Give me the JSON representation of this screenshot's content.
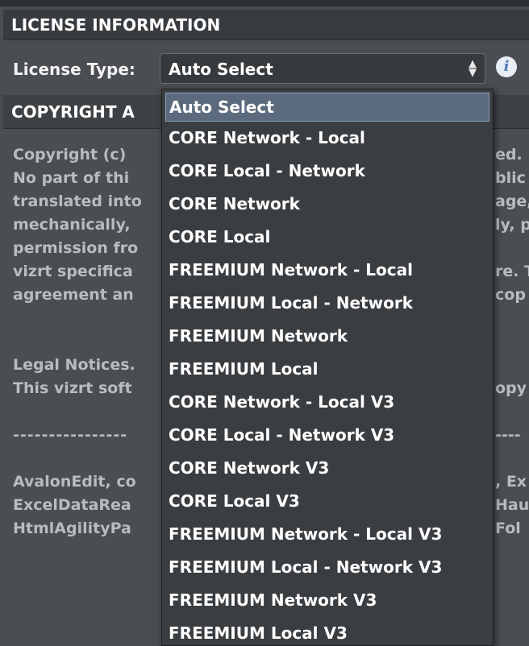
{
  "license_section": {
    "title": "LICENSE INFORMATION",
    "license_type_label": "License Type:",
    "selected_value": "Auto Select",
    "select_arrows": "▲▼",
    "info_glyph": "i"
  },
  "copyright_section": {
    "title_visible": "COPYRIGHT A",
    "lines_left": [
      "Copyright (c)",
      "No part of thi",
      "translated into",
      "mechanically,",
      "permission fro",
      "vizrt specifica",
      "agreement an",
      "",
      "",
      "Legal Notices.",
      "This vizrt soft",
      "",
      "----------------",
      "",
      "AvalonEdit, co",
      "ExcelDataRea",
      "HtmlAgilityPa"
    ],
    "lines_right": [
      "ed.",
      "blic",
      "age,",
      "ly, p",
      "",
      "re. T",
      "cop",
      "",
      "",
      "",
      "opy",
      "",
      "----",
      "",
      ", Ex",
      "Hau",
      "Fol"
    ]
  },
  "dropdown": {
    "options": [
      "Auto Select",
      "CORE Network - Local",
      "CORE Local - Network",
      "CORE Network",
      "CORE Local",
      "FREEMIUM Network - Local",
      "FREEMIUM Local - Network",
      "FREEMIUM Network",
      "FREEMIUM Local",
      "CORE Network - Local V3",
      "CORE Local - Network V3",
      "CORE Network V3",
      "CORE Local V3",
      "FREEMIUM Network - Local V3",
      "FREEMIUM Local - Network V3",
      "FREEMIUM Network V3",
      "FREEMIUM Local V3"
    ],
    "selected_index": 0
  },
  "colors": {
    "panel_bg": "#4a4d51",
    "header_bg": "#393c3f",
    "dropdown_bg": "#3b3e41",
    "selected_bg": "#5b6b7d",
    "info_icon": "#4b78b8"
  }
}
